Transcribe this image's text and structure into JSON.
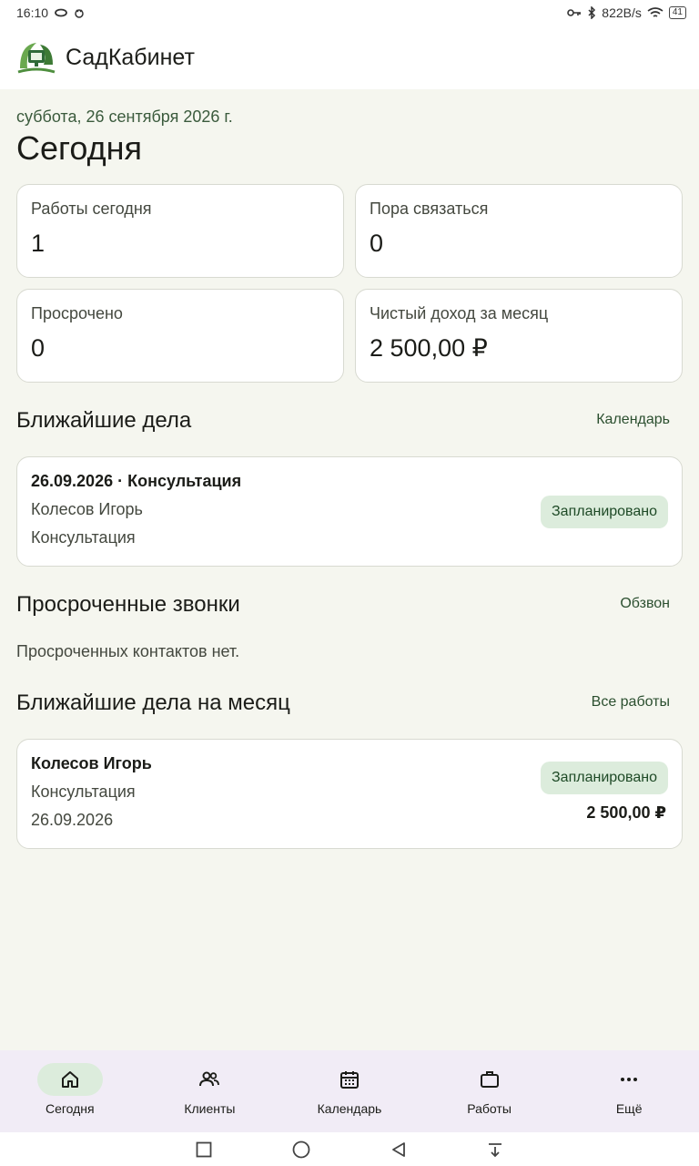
{
  "status": {
    "time": "16:10",
    "speed": "822B/s",
    "battery": "41"
  },
  "app": {
    "title": "СадКабинет"
  },
  "header": {
    "date": "суббота, 26 сентября 2026 г.",
    "title": "Сегодня"
  },
  "stats": [
    {
      "label": "Работы сегодня",
      "value": "1"
    },
    {
      "label": "Пора связаться",
      "value": "0"
    },
    {
      "label": "Просрочено",
      "value": "0"
    },
    {
      "label": "Чистый доход за месяц",
      "value": "2 500,00 ₽"
    }
  ],
  "upcoming": {
    "title": "Ближайшие дела",
    "link": "Календарь",
    "item": {
      "date_type": "26.09.2026 · Консультация",
      "client": "Колесов Игорь",
      "service": "Консультация",
      "status": "Запланировано"
    }
  },
  "overdue": {
    "title": "Просроченные звонки",
    "link": "Обзвон",
    "empty": "Просроченных контактов нет."
  },
  "month": {
    "title": "Ближайшие дела на месяц",
    "link": "Все работы",
    "item": {
      "client": "Колесов Игорь",
      "service": "Консультация",
      "date": "26.09.2026",
      "status": "Запланировано",
      "amount": "2 500,00 ₽"
    }
  },
  "nav": [
    {
      "label": "Сегодня",
      "icon": "home-icon"
    },
    {
      "label": "Клиенты",
      "icon": "people-icon"
    },
    {
      "label": "Календарь",
      "icon": "calendar-icon"
    },
    {
      "label": "Работы",
      "icon": "briefcase-icon"
    },
    {
      "label": "Ещё",
      "icon": "more-icon"
    }
  ]
}
